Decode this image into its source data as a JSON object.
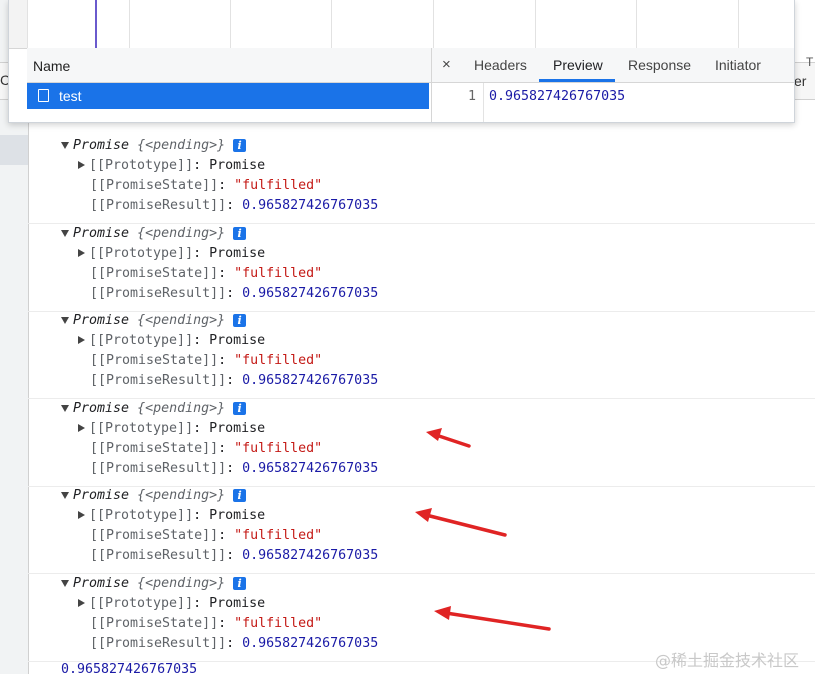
{
  "colors": {
    "accent": "#1a73e8",
    "string": "#c41a16",
    "number": "#1a1aa6",
    "arrow": "#e02424"
  },
  "background": {
    "left_tab_fragment": "C",
    "right_tab_fragment": "er",
    "right_tab_tick": "T"
  },
  "network": {
    "name_header": "Name",
    "rows": [
      {
        "name": "test",
        "icon": "document-icon"
      }
    ],
    "close_icon": "×",
    "tabs": [
      "Headers",
      "Preview",
      "Response",
      "Initiator"
    ],
    "active_tab": "Preview",
    "preview": {
      "line_number": "1",
      "value": "0.965827426767035"
    }
  },
  "console": {
    "entries": [
      {
        "summary_type": "Promise",
        "summary_state": "{<pending>}",
        "info": "i",
        "prototype_key": "[[Prototype]]",
        "prototype_value": "Promise",
        "state_key": "[[PromiseState]]",
        "state_value": "\"fulfilled\"",
        "result_key": "[[PromiseResult]]",
        "result_value": "0.965827426767035"
      },
      {
        "summary_type": "Promise",
        "summary_state": "{<pending>}",
        "info": "i",
        "prototype_key": "[[Prototype]]",
        "prototype_value": "Promise",
        "state_key": "[[PromiseState]]",
        "state_value": "\"fulfilled\"",
        "result_key": "[[PromiseResult]]",
        "result_value": "0.965827426767035"
      },
      {
        "summary_type": "Promise",
        "summary_state": "{<pending>}",
        "info": "i",
        "prototype_key": "[[Prototype]]",
        "prototype_value": "Promise",
        "state_key": "[[PromiseState]]",
        "state_value": "\"fulfilled\"",
        "result_key": "[[PromiseResult]]",
        "result_value": "0.965827426767035"
      },
      {
        "summary_type": "Promise",
        "summary_state": "{<pending>}",
        "info": "i",
        "prototype_key": "[[Prototype]]",
        "prototype_value": "Promise",
        "state_key": "[[PromiseState]]",
        "state_value": "\"fulfilled\"",
        "result_key": "[[PromiseResult]]",
        "result_value": "0.965827426767035"
      },
      {
        "summary_type": "Promise",
        "summary_state": "{<pending>}",
        "info": "i",
        "prototype_key": "[[Prototype]]",
        "prototype_value": "Promise",
        "state_key": "[[PromiseState]]",
        "state_value": "\"fulfilled\"",
        "result_key": "[[PromiseResult]]",
        "result_value": "0.965827426767035"
      },
      {
        "summary_type": "Promise",
        "summary_state": "{<pending>}",
        "info": "i",
        "prototype_key": "[[Prototype]]",
        "prototype_value": "Promise",
        "state_key": "[[PromiseState]]",
        "state_value": "\"fulfilled\"",
        "result_key": "[[PromiseResult]]",
        "result_value": "0.965827426767035"
      }
    ],
    "final_output": "0.965827426767035"
  },
  "watermark": "@稀土掘金技术社区"
}
